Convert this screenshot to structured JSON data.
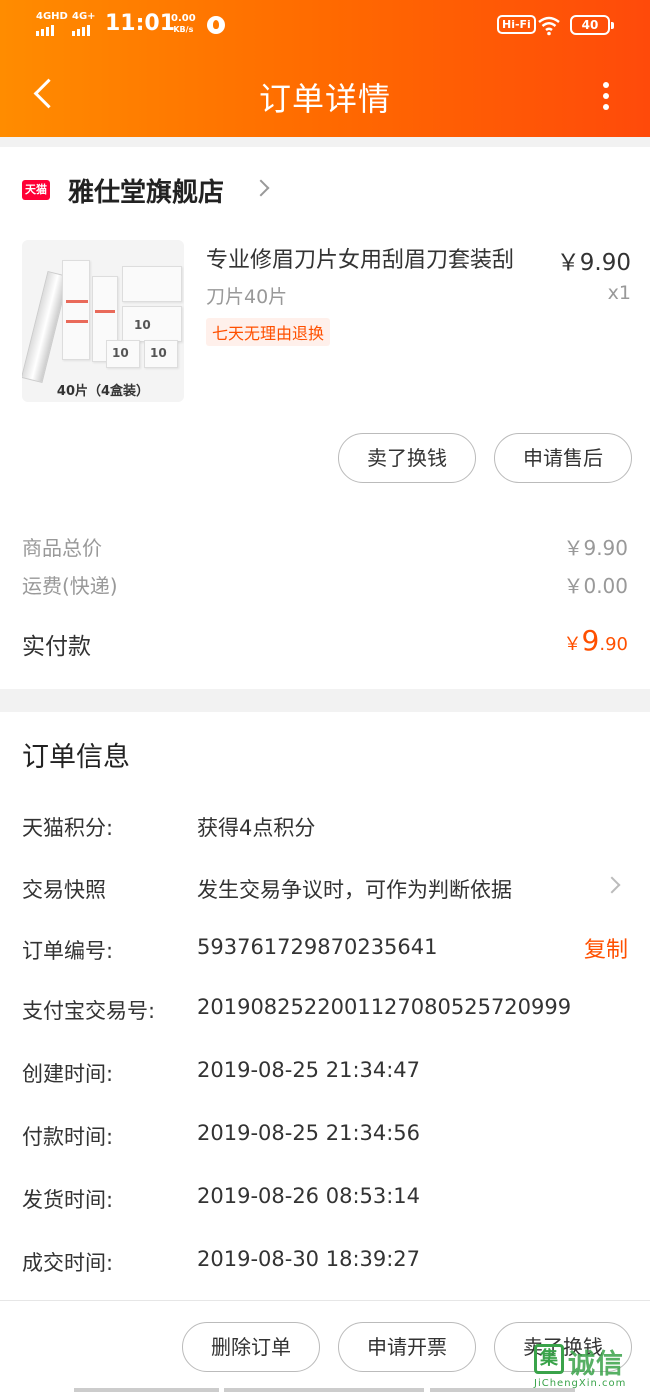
{
  "status_bar": {
    "sim1": "4GHD",
    "sim2": "4G+",
    "time": "11:01",
    "speed_value": "0.00",
    "speed_unit": "KB/s",
    "hifi": "Hi-Fi",
    "battery": "40"
  },
  "header": {
    "title": "订单详情",
    "back_icon": "chevron-left-icon",
    "more_icon": "vertical-dots-icon"
  },
  "shop": {
    "badge": "天猫",
    "name": "雅仕堂旗舰店"
  },
  "product": {
    "title": "专业修眉刀片女用刮眉刀套装刮",
    "price": "￥9.90",
    "sku": "刀片40片",
    "quantity": "x1",
    "tag": "七天无理由退换",
    "image_caption": "40片（4盒装）",
    "image_box_label": "10"
  },
  "item_actions": {
    "sell_label": "卖了换钱",
    "after_sale_label": "申请售后"
  },
  "summary": {
    "total_label": "商品总价",
    "total_value": "￥9.90",
    "shipping_label": "运费(快递)",
    "shipping_value": "￥0.00",
    "paid_label": "实付款",
    "paid_currency": "￥",
    "paid_integer": "9",
    "paid_decimal": ".90"
  },
  "order_info": {
    "title": "订单信息",
    "rows": [
      {
        "label": "天猫积分:",
        "value": "获得4点积分"
      },
      {
        "label": "交易快照",
        "value": "发生交易争议时，可作为判断依据"
      },
      {
        "label": "订单编号:",
        "value": "593761729870235641"
      },
      {
        "label": "支付宝交易号:",
        "value": "2019082522001127080525720999"
      },
      {
        "label": "创建时间:",
        "value": "2019-08-25 21:34:47"
      },
      {
        "label": "付款时间:",
        "value": "2019-08-25 21:34:56"
      },
      {
        "label": "发货时间:",
        "value": "2019-08-26 08:53:14"
      },
      {
        "label": "成交时间:",
        "value": "2019-08-30 18:39:27"
      }
    ],
    "copy_label": "复制"
  },
  "bottom_actions": {
    "delete_label": "删除订单",
    "invoice_label": "申请开票",
    "sell_label": "卖了换钱"
  },
  "watermark": {
    "logo_char": "集",
    "cn": "诚信",
    "en": "JiChengXin.com",
    "color": "#3aa34a"
  },
  "colors": {
    "accent": "#ff5000",
    "header_start": "#ff8c00",
    "header_end": "#ff4a0a",
    "tmall_red": "#ff0036"
  }
}
